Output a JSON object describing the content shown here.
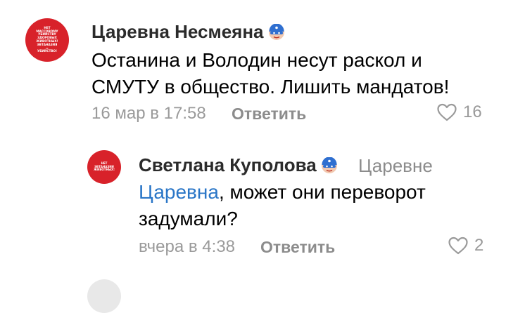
{
  "comment1": {
    "avatar_lines": [
      "Нет",
      "массовому",
      "убийству",
      "здоровых",
      "животных!",
      "Эвтаназия",
      "=",
      "убийство!"
    ],
    "author": "Царевна Несмеяна",
    "badge_icon": "masked-face-icon",
    "text_line1": "Останина и Володин несут раскол  и",
    "text_line2": "СМУТУ в общество. Лишить мандатов!",
    "timestamp": "16 мар в 17:58",
    "reply_label": "Ответить",
    "likes": "16"
  },
  "comment2": {
    "avatar_lines": [
      "Нет",
      "эвтаназии",
      "животных!"
    ],
    "author": "Светлана Куполова",
    "badge_icon": "masked-face-icon",
    "reply_to": "Царевне",
    "mention": "Царевна",
    "text_line1_rest": ", может они переворот",
    "text_line2": "задумали?",
    "timestamp": "вчера в 4:38",
    "reply_label": "Ответить",
    "likes": "2"
  },
  "colors": {
    "avatar_red": "#d8222a",
    "link_blue": "#2a76c7",
    "muted_gray": "#9a9a9a"
  }
}
